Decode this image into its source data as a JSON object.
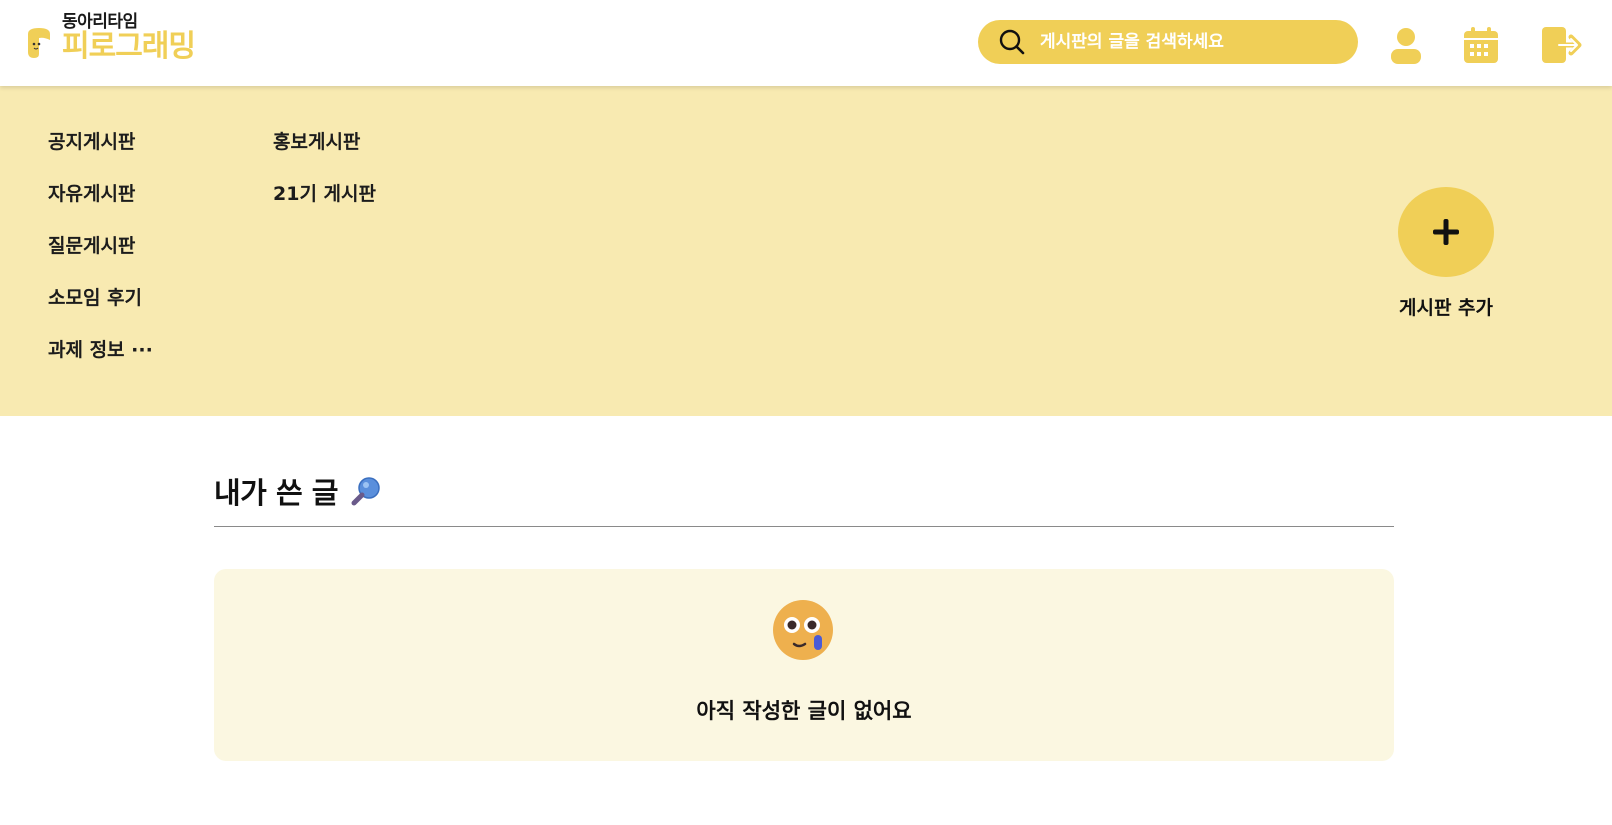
{
  "header": {
    "logo_top": "동아리타임",
    "logo_main": "피로그래밍",
    "search_placeholder": "게시판의 글을 검색하세요",
    "icons": [
      "profile-icon",
      "calendar-icon",
      "logout-icon"
    ]
  },
  "boards": {
    "column1": [
      "공지게시판",
      "자유게시판",
      "질문게시판",
      "소모임 후기",
      "과제 정보 ···"
    ],
    "column2": [
      "홍보게시판",
      "21기 게시판"
    ],
    "add_label": "게시판 추가"
  },
  "my_posts": {
    "title": "내가 쓴 글",
    "empty_message": "아직 작성한 글이 없어요"
  },
  "colors": {
    "accent": "#f0cf57",
    "menu_bg": "#f8eab1",
    "card_bg": "#fbf7e1"
  }
}
